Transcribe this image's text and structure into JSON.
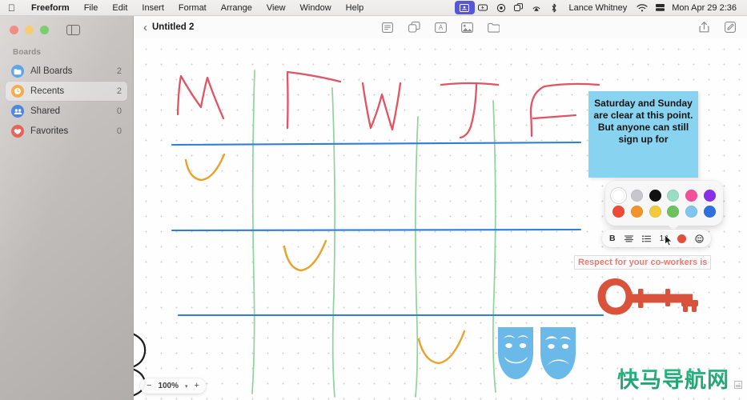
{
  "menubar": {
    "apple_icon": "apple-icon",
    "items": [
      "Freeform",
      "File",
      "Edit",
      "Insert",
      "Format",
      "Arrange",
      "View",
      "Window",
      "Help"
    ],
    "status_icons": [
      "screen-share-icon",
      "battery-icon",
      "siri-icon",
      "control-center-icon",
      "airplay-icon",
      "bluetooth-icon"
    ],
    "user": "Lance Whitney",
    "wifi_icon": "wifi-icon",
    "search_icon": "spotlight-icon",
    "clock": "Mon Apr 29  2:36"
  },
  "window": {
    "traffic_lights": [
      "close-button",
      "minimize-button",
      "maximize-button"
    ],
    "sidebar_toggle_icon": "sidebar-toggle-icon"
  },
  "sidebar": {
    "section_title": "Boards",
    "items": [
      {
        "label": "All Boards",
        "count": "2",
        "icon": "all-boards-icon",
        "selected": false
      },
      {
        "label": "Recents",
        "count": "2",
        "icon": "recents-clock-icon",
        "selected": true
      },
      {
        "label": "Shared",
        "count": "0",
        "icon": "shared-people-icon",
        "selected": false
      },
      {
        "label": "Favorites",
        "count": "0",
        "icon": "favorites-heart-icon",
        "selected": false
      }
    ]
  },
  "toolbar": {
    "back_icon": "back-chevron-icon",
    "title": "Untitled 2",
    "center_icons": [
      "sticky-note-icon",
      "shapes-icon",
      "text-box-icon",
      "media-icon",
      "insert-file-icon"
    ],
    "right_icons": [
      "share-icon",
      "compose-icon"
    ]
  },
  "canvas": {
    "sticky_note": {
      "text": "Saturday and Sunday are clear at this point. But anyone can still sign up for",
      "color": "#87d3f0"
    },
    "red_text_box": {
      "text": "Respect for your co-workers is",
      "color": "#eb7a72"
    },
    "handwriting": {
      "letters": [
        "M",
        "T",
        "W",
        "T",
        "F"
      ],
      "ink_color": "#e05464"
    },
    "lines": {
      "horizontal_color": "#2f7fd8",
      "vertical_color": "#92d49b",
      "curve_color": "#eaa22d"
    },
    "art": [
      {
        "name": "key-shape",
        "color": "#d9533c"
      },
      {
        "name": "theater-masks-shape",
        "color": "#6ab9e8"
      }
    ]
  },
  "color_popover": {
    "row1": [
      "#ffffff",
      "#c6c6cb",
      "#111111",
      "#9adcc4",
      "#f2519a",
      "#8b2ee8"
    ],
    "row1_names": [
      "white",
      "gray",
      "black",
      "mint",
      "pink",
      "purple"
    ],
    "row2": [
      "#ec4b35",
      "#f0932b",
      "#f2cb3a",
      "#6cc35e",
      "#7ec5ef",
      "#2f6fe0"
    ],
    "row2_names": [
      "red",
      "orange",
      "yellow",
      "green",
      "light-blue",
      "blue"
    ],
    "selected": "#ffffff"
  },
  "format_bar": {
    "bold_label": "B",
    "align_icon": "align-center-icon",
    "list_icon": "bullet-list-icon",
    "font_size": "18",
    "color_swatch": "#e0503c",
    "emoji_icon": "emoji-icon"
  },
  "zoom_control": {
    "minus": "−",
    "value": "100%",
    "chevron": "▾",
    "plus": "+"
  },
  "watermark": {
    "text": "快马导航网"
  }
}
